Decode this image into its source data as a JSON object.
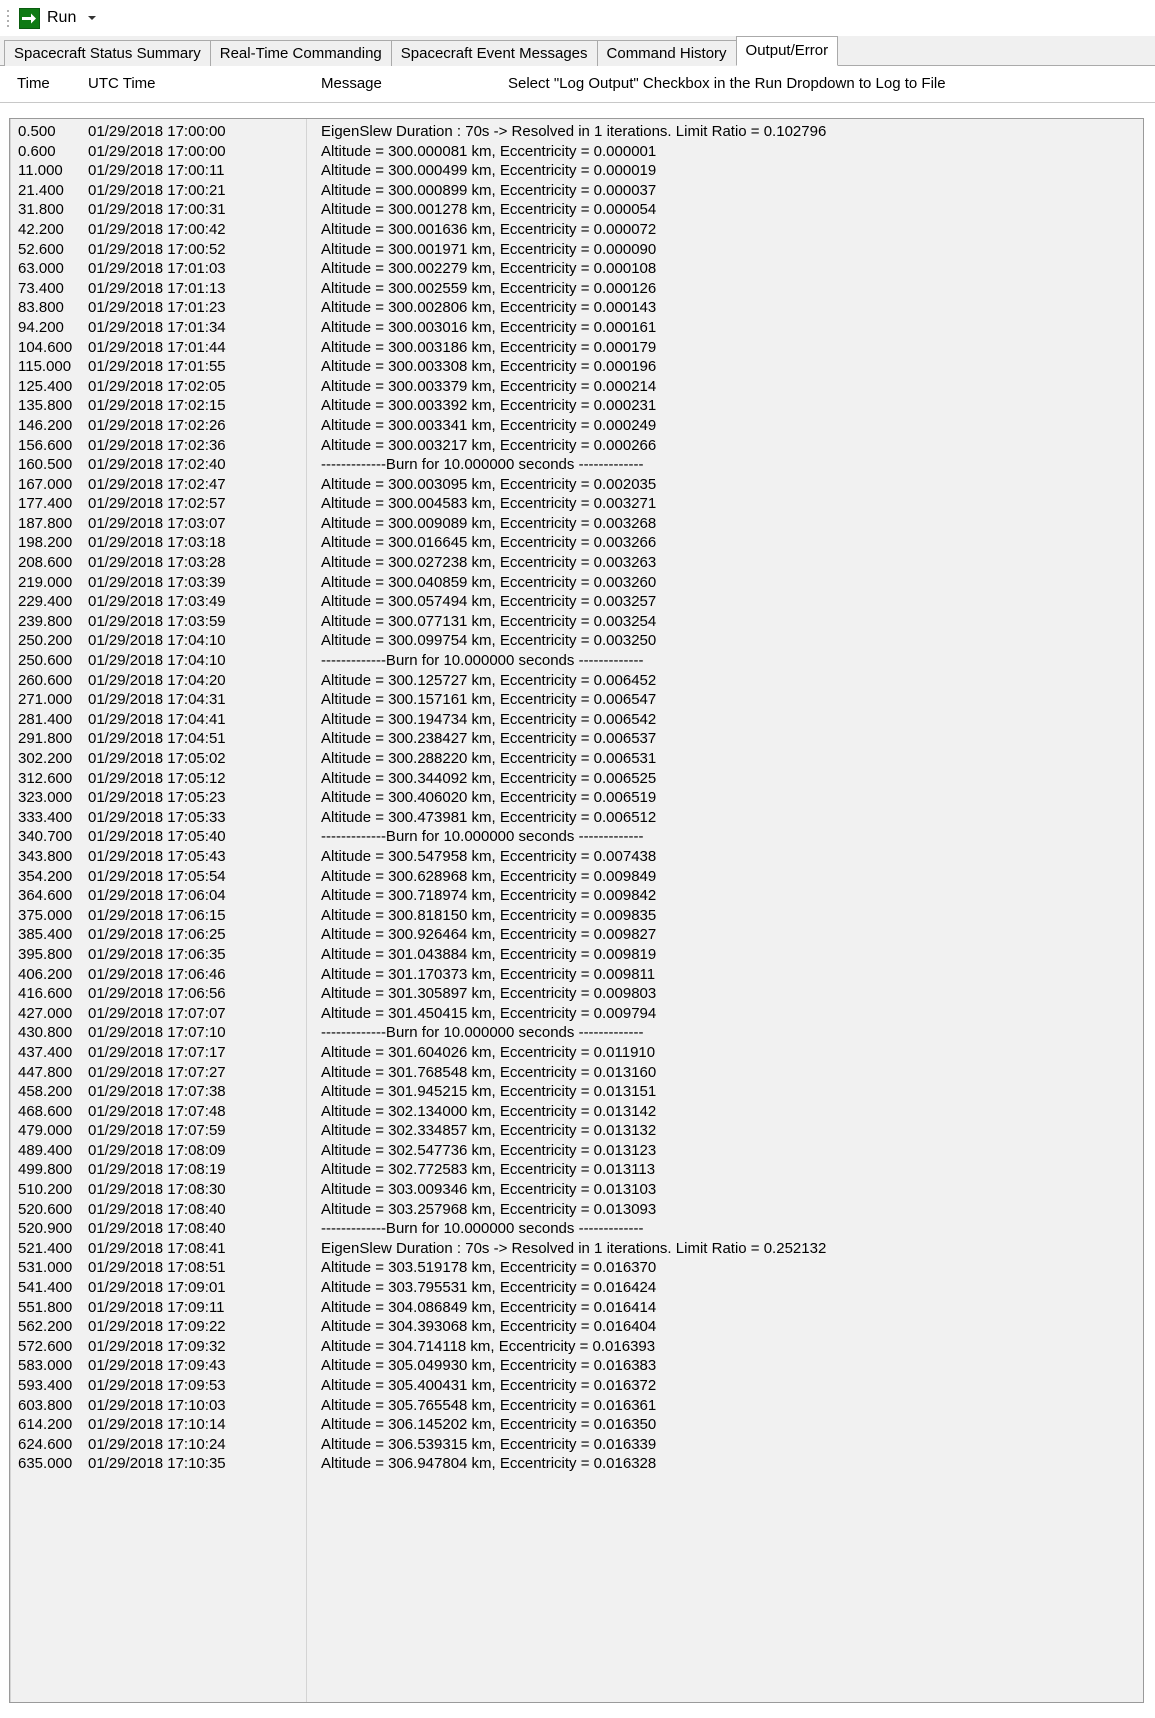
{
  "toolbar": {
    "run_label": "Run",
    "run_icon": "arrow-right-icon",
    "dropdown_icon": "chevron-down-icon"
  },
  "tabs": [
    {
      "label": "Spacecraft Status Summary",
      "active": false
    },
    {
      "label": "Real-Time Commanding",
      "active": false
    },
    {
      "label": "Spacecraft Event Messages",
      "active": false
    },
    {
      "label": "Command History",
      "active": false
    },
    {
      "label": "Output/Error",
      "active": true
    }
  ],
  "columns": {
    "time": "Time",
    "utc_time": "UTC Time",
    "message": "Message",
    "hint": "Select \"Log Output\" Checkbox in the Run Dropdown to Log to File"
  },
  "rows": [
    {
      "time": "0.500",
      "utc": "01/29/2018 17:00:00",
      "msg": "EigenSlew Duration : 70s -> Resolved in 1 iterations.  Limit Ratio = 0.102796"
    },
    {
      "time": "0.600",
      "utc": "01/29/2018 17:00:00",
      "msg": "Altitude = 300.000081 km, Eccentricity = 0.000001"
    },
    {
      "time": "11.000",
      "utc": "01/29/2018 17:00:11",
      "msg": "Altitude = 300.000499 km, Eccentricity = 0.000019"
    },
    {
      "time": "21.400",
      "utc": "01/29/2018 17:00:21",
      "msg": "Altitude = 300.000899 km, Eccentricity = 0.000037"
    },
    {
      "time": "31.800",
      "utc": "01/29/2018 17:00:31",
      "msg": "Altitude = 300.001278 km, Eccentricity = 0.000054"
    },
    {
      "time": "42.200",
      "utc": "01/29/2018 17:00:42",
      "msg": "Altitude = 300.001636 km, Eccentricity = 0.000072"
    },
    {
      "time": "52.600",
      "utc": "01/29/2018 17:00:52",
      "msg": "Altitude = 300.001971 km, Eccentricity = 0.000090"
    },
    {
      "time": "63.000",
      "utc": "01/29/2018 17:01:03",
      "msg": "Altitude = 300.002279 km, Eccentricity = 0.000108"
    },
    {
      "time": "73.400",
      "utc": "01/29/2018 17:01:13",
      "msg": "Altitude = 300.002559 km, Eccentricity = 0.000126"
    },
    {
      "time": "83.800",
      "utc": "01/29/2018 17:01:23",
      "msg": "Altitude = 300.002806 km, Eccentricity = 0.000143"
    },
    {
      "time": "94.200",
      "utc": "01/29/2018 17:01:34",
      "msg": "Altitude = 300.003016 km, Eccentricity = 0.000161"
    },
    {
      "time": "104.600",
      "utc": "01/29/2018 17:01:44",
      "msg": "Altitude = 300.003186 km, Eccentricity = 0.000179"
    },
    {
      "time": "115.000",
      "utc": "01/29/2018 17:01:55",
      "msg": "Altitude = 300.003308 km, Eccentricity = 0.000196"
    },
    {
      "time": "125.400",
      "utc": "01/29/2018 17:02:05",
      "msg": "Altitude = 300.003379 km, Eccentricity = 0.000214"
    },
    {
      "time": "135.800",
      "utc": "01/29/2018 17:02:15",
      "msg": "Altitude = 300.003392 km, Eccentricity = 0.000231"
    },
    {
      "time": "146.200",
      "utc": "01/29/2018 17:02:26",
      "msg": "Altitude = 300.003341 km, Eccentricity = 0.000249"
    },
    {
      "time": "156.600",
      "utc": "01/29/2018 17:02:36",
      "msg": "Altitude = 300.003217 km, Eccentricity = 0.000266"
    },
    {
      "time": "160.500",
      "utc": "01/29/2018 17:02:40",
      "msg": "-------------Burn for 10.000000 seconds -------------"
    },
    {
      "time": "167.000",
      "utc": "01/29/2018 17:02:47",
      "msg": "Altitude = 300.003095 km, Eccentricity = 0.002035"
    },
    {
      "time": "177.400",
      "utc": "01/29/2018 17:02:57",
      "msg": "Altitude = 300.004583 km, Eccentricity = 0.003271"
    },
    {
      "time": "187.800",
      "utc": "01/29/2018 17:03:07",
      "msg": "Altitude = 300.009089 km, Eccentricity = 0.003268"
    },
    {
      "time": "198.200",
      "utc": "01/29/2018 17:03:18",
      "msg": "Altitude = 300.016645 km, Eccentricity = 0.003266"
    },
    {
      "time": "208.600",
      "utc": "01/29/2018 17:03:28",
      "msg": "Altitude = 300.027238 km, Eccentricity = 0.003263"
    },
    {
      "time": "219.000",
      "utc": "01/29/2018 17:03:39",
      "msg": "Altitude = 300.040859 km, Eccentricity = 0.003260"
    },
    {
      "time": "229.400",
      "utc": "01/29/2018 17:03:49",
      "msg": "Altitude = 300.057494 km, Eccentricity = 0.003257"
    },
    {
      "time": "239.800",
      "utc": "01/29/2018 17:03:59",
      "msg": "Altitude = 300.077131 km, Eccentricity = 0.003254"
    },
    {
      "time": "250.200",
      "utc": "01/29/2018 17:04:10",
      "msg": "Altitude = 300.099754 km, Eccentricity = 0.003250"
    },
    {
      "time": "250.600",
      "utc": "01/29/2018 17:04:10",
      "msg": "-------------Burn for 10.000000 seconds -------------"
    },
    {
      "time": "260.600",
      "utc": "01/29/2018 17:04:20",
      "msg": "Altitude = 300.125727 km, Eccentricity = 0.006452"
    },
    {
      "time": "271.000",
      "utc": "01/29/2018 17:04:31",
      "msg": "Altitude = 300.157161 km, Eccentricity = 0.006547"
    },
    {
      "time": "281.400",
      "utc": "01/29/2018 17:04:41",
      "msg": "Altitude = 300.194734 km, Eccentricity = 0.006542"
    },
    {
      "time": "291.800",
      "utc": "01/29/2018 17:04:51",
      "msg": "Altitude = 300.238427 km, Eccentricity = 0.006537"
    },
    {
      "time": "302.200",
      "utc": "01/29/2018 17:05:02",
      "msg": "Altitude = 300.288220 km, Eccentricity = 0.006531"
    },
    {
      "time": "312.600",
      "utc": "01/29/2018 17:05:12",
      "msg": "Altitude = 300.344092 km, Eccentricity = 0.006525"
    },
    {
      "time": "323.000",
      "utc": "01/29/2018 17:05:23",
      "msg": "Altitude = 300.406020 km, Eccentricity = 0.006519"
    },
    {
      "time": "333.400",
      "utc": "01/29/2018 17:05:33",
      "msg": "Altitude = 300.473981 km, Eccentricity = 0.006512"
    },
    {
      "time": "340.700",
      "utc": "01/29/2018 17:05:40",
      "msg": "-------------Burn for 10.000000 seconds -------------"
    },
    {
      "time": "343.800",
      "utc": "01/29/2018 17:05:43",
      "msg": "Altitude = 300.547958 km, Eccentricity = 0.007438"
    },
    {
      "time": "354.200",
      "utc": "01/29/2018 17:05:54",
      "msg": "Altitude = 300.628968 km, Eccentricity = 0.009849"
    },
    {
      "time": "364.600",
      "utc": "01/29/2018 17:06:04",
      "msg": "Altitude = 300.718974 km, Eccentricity = 0.009842"
    },
    {
      "time": "375.000",
      "utc": "01/29/2018 17:06:15",
      "msg": "Altitude = 300.818150 km, Eccentricity = 0.009835"
    },
    {
      "time": "385.400",
      "utc": "01/29/2018 17:06:25",
      "msg": "Altitude = 300.926464 km, Eccentricity = 0.009827"
    },
    {
      "time": "395.800",
      "utc": "01/29/2018 17:06:35",
      "msg": "Altitude = 301.043884 km, Eccentricity = 0.009819"
    },
    {
      "time": "406.200",
      "utc": "01/29/2018 17:06:46",
      "msg": "Altitude = 301.170373 km, Eccentricity = 0.009811"
    },
    {
      "time": "416.600",
      "utc": "01/29/2018 17:06:56",
      "msg": "Altitude = 301.305897 km, Eccentricity = 0.009803"
    },
    {
      "time": "427.000",
      "utc": "01/29/2018 17:07:07",
      "msg": "Altitude = 301.450415 km, Eccentricity = 0.009794"
    },
    {
      "time": "430.800",
      "utc": "01/29/2018 17:07:10",
      "msg": "-------------Burn for 10.000000 seconds -------------"
    },
    {
      "time": "437.400",
      "utc": "01/29/2018 17:07:17",
      "msg": "Altitude = 301.604026 km, Eccentricity = 0.011910"
    },
    {
      "time": "447.800",
      "utc": "01/29/2018 17:07:27",
      "msg": "Altitude = 301.768548 km, Eccentricity = 0.013160"
    },
    {
      "time": "458.200",
      "utc": "01/29/2018 17:07:38",
      "msg": "Altitude = 301.945215 km, Eccentricity = 0.013151"
    },
    {
      "time": "468.600",
      "utc": "01/29/2018 17:07:48",
      "msg": "Altitude = 302.134000 km, Eccentricity = 0.013142"
    },
    {
      "time": "479.000",
      "utc": "01/29/2018 17:07:59",
      "msg": "Altitude = 302.334857 km, Eccentricity = 0.013132"
    },
    {
      "time": "489.400",
      "utc": "01/29/2018 17:08:09",
      "msg": "Altitude = 302.547736 km, Eccentricity = 0.013123"
    },
    {
      "time": "499.800",
      "utc": "01/29/2018 17:08:19",
      "msg": "Altitude = 302.772583 km, Eccentricity = 0.013113"
    },
    {
      "time": "510.200",
      "utc": "01/29/2018 17:08:30",
      "msg": "Altitude = 303.009346 km, Eccentricity = 0.013103"
    },
    {
      "time": "520.600",
      "utc": "01/29/2018 17:08:40",
      "msg": "Altitude = 303.257968 km, Eccentricity = 0.013093"
    },
    {
      "time": "520.900",
      "utc": "01/29/2018 17:08:40",
      "msg": "-------------Burn for 10.000000 seconds -------------"
    },
    {
      "time": "521.400",
      "utc": "01/29/2018 17:08:41",
      "msg": "EigenSlew Duration : 70s -> Resolved in 1 iterations.  Limit Ratio = 0.252132"
    },
    {
      "time": "531.000",
      "utc": "01/29/2018 17:08:51",
      "msg": "Altitude = 303.519178 km, Eccentricity = 0.016370"
    },
    {
      "time": "541.400",
      "utc": "01/29/2018 17:09:01",
      "msg": "Altitude = 303.795531 km, Eccentricity = 0.016424"
    },
    {
      "time": "551.800",
      "utc": "01/29/2018 17:09:11",
      "msg": "Altitude = 304.086849 km, Eccentricity = 0.016414"
    },
    {
      "time": "562.200",
      "utc": "01/29/2018 17:09:22",
      "msg": "Altitude = 304.393068 km, Eccentricity = 0.016404"
    },
    {
      "time": "572.600",
      "utc": "01/29/2018 17:09:32",
      "msg": "Altitude = 304.714118 km, Eccentricity = 0.016393"
    },
    {
      "time": "583.000",
      "utc": "01/29/2018 17:09:43",
      "msg": "Altitude = 305.049930 km, Eccentricity = 0.016383"
    },
    {
      "time": "593.400",
      "utc": "01/29/2018 17:09:53",
      "msg": "Altitude = 305.400431 km, Eccentricity = 0.016372"
    },
    {
      "time": "603.800",
      "utc": "01/29/2018 17:10:03",
      "msg": "Altitude = 305.765548 km, Eccentricity = 0.016361"
    },
    {
      "time": "614.200",
      "utc": "01/29/2018 17:10:14",
      "msg": "Altitude = 306.145202 km, Eccentricity = 0.016350"
    },
    {
      "time": "624.600",
      "utc": "01/29/2018 17:10:24",
      "msg": "Altitude = 306.539315 km, Eccentricity = 0.016339"
    },
    {
      "time": "635.000",
      "utc": "01/29/2018 17:10:35",
      "msg": "Altitude = 306.947804 km, Eccentricity = 0.016328"
    }
  ],
  "colors": {
    "run_icon_green": "#0f7a14",
    "list_background": "#f1f1f1",
    "tab_inactive": "#f0f0f0",
    "tab_active": "#ffffff",
    "border": "#9a9a9a"
  }
}
